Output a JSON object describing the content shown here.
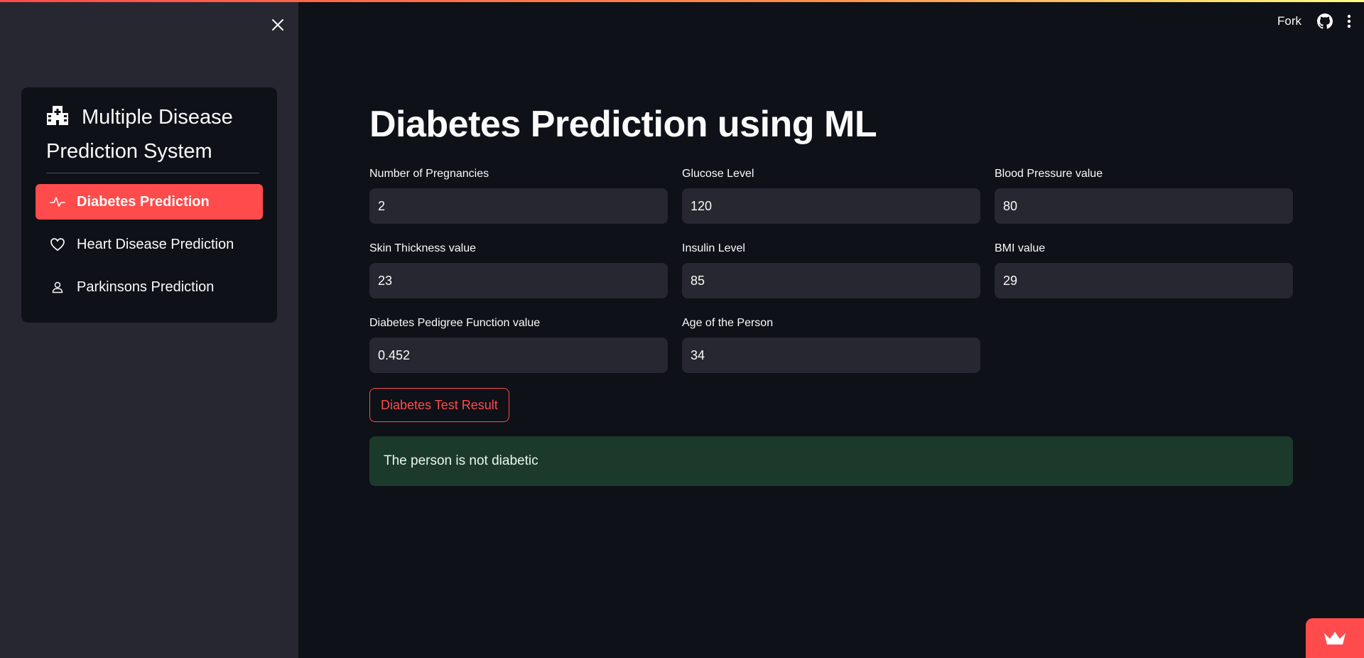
{
  "header": {
    "fork_label": "Fork",
    "accent_gradient": [
      "#ff4b4b",
      "#ff8f4b",
      "#fffd80"
    ]
  },
  "sidebar": {
    "menu_title": "Multiple Disease Prediction System",
    "items": [
      {
        "label": "Diabetes Prediction",
        "icon": "activity-icon",
        "active": true
      },
      {
        "label": "Heart Disease Prediction",
        "icon": "heart-icon",
        "active": false
      },
      {
        "label": "Parkinsons Prediction",
        "icon": "person-icon",
        "active": false
      }
    ]
  },
  "main": {
    "title": "Diabetes Prediction using ML",
    "fields": [
      {
        "label": "Number of Pregnancies",
        "value": "2"
      },
      {
        "label": "Glucose Level",
        "value": "120"
      },
      {
        "label": "Blood Pressure value",
        "value": "80"
      },
      {
        "label": "Skin Thickness value",
        "value": "23"
      },
      {
        "label": "Insulin Level",
        "value": "85"
      },
      {
        "label": "BMI value",
        "value": "29"
      },
      {
        "label": "Diabetes Pedigree Function value",
        "value": "0.452"
      },
      {
        "label": "Age of the Person",
        "value": "34"
      }
    ],
    "result_button_label": "Diabetes Test Result",
    "result_message": "The person is not diabetic"
  },
  "colors": {
    "primary": "#ff4b4b",
    "background": "#0e1117",
    "sidebar_bg": "#262730",
    "success_bg": "#1b3a2b"
  }
}
